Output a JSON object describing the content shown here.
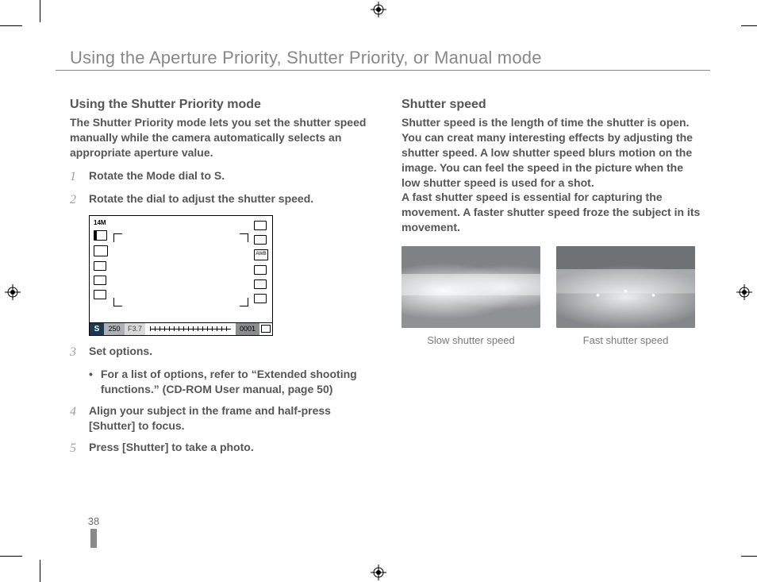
{
  "title": "Using the Aperture Priority, Shutter Priority, or Manual mode",
  "page_number": "38",
  "left": {
    "subhead": "Using the Shutter Priority mode",
    "lead": "The Shutter Priority mode lets you set the shutter speed manually while the camera automatically selects an appropriate aperture value.",
    "step1_a": "Rotate the Mode dial to ",
    "step1_b": "S",
    "step1_c": ".",
    "step2": "Rotate the dial to adjust the shutter speed.",
    "step3": "Set options.",
    "step3_bullet": "For a list of options, refer to “Extended shooting functions.” (CD-ROM User manual, page 50)",
    "step4_a": "Align your subject in the frame and half-press ",
    "step4_b": "[Shutter]",
    "step4_c": " to focus.",
    "step5_a": "Press ",
    "step5_b": "[Shutter]",
    "step5_c": " to take a photo.",
    "lcd": {
      "mode": "S",
      "shutter": "250",
      "aperture": "F3.7",
      "counter": "0001",
      "megapixel": "14M"
    }
  },
  "right": {
    "subhead": "Shutter speed",
    "body": "Shutter speed is the length of time the shutter is open. You can creat many interesting effects by adjusting the shutter speed. A low shutter speed blurs motion on the image. You can feel the speed in the picture when the low shutter speed is used for a shot.\nA fast shutter speed is essential for capturing the movement. A faster shutter speed froze the subject in its movement.",
    "caption_slow": "Slow shutter speed",
    "caption_fast": "Fast shutter speed"
  }
}
